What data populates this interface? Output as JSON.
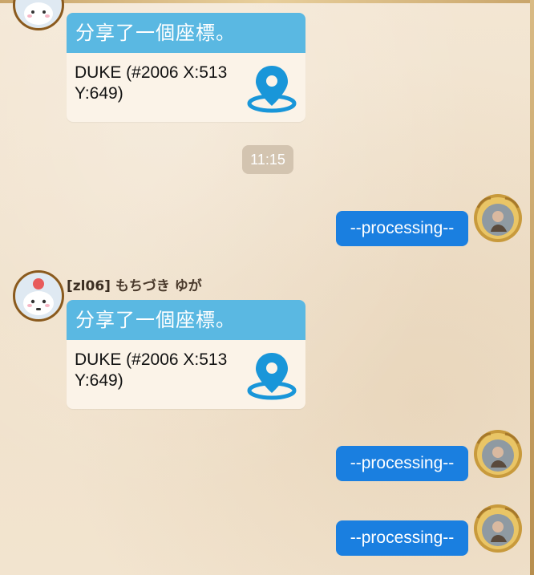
{
  "messages": [
    {
      "type": "location",
      "header": "分享了一個座標。",
      "line1": "DUKE (#2006 X:513",
      "line2": "Y:649)"
    },
    {
      "type": "timestamp",
      "text": "11:15"
    },
    {
      "type": "outgoing",
      "text": "--processing--"
    },
    {
      "type": "location",
      "sender_tag": "[zl06]",
      "sender_name": "もちづき ゆが",
      "header": "分享了一個座標。",
      "line1": "DUKE (#2006 X:513",
      "line2": "Y:649)"
    },
    {
      "type": "outgoing",
      "text": "--processing--"
    },
    {
      "type": "outgoing",
      "text": "--processing--"
    }
  ],
  "icons": {
    "location_pin": "map-pin-icon",
    "avatar_other": "cute-character-avatar",
    "avatar_self": "ornate-portrait-avatar"
  },
  "colors": {
    "card_header": "#5ab8e2",
    "bubble_outgoing": "#1a7fe0",
    "pin": "#1996d9",
    "timestamp_bg": "#d3c4b0",
    "background": "#f1e3cd"
  }
}
